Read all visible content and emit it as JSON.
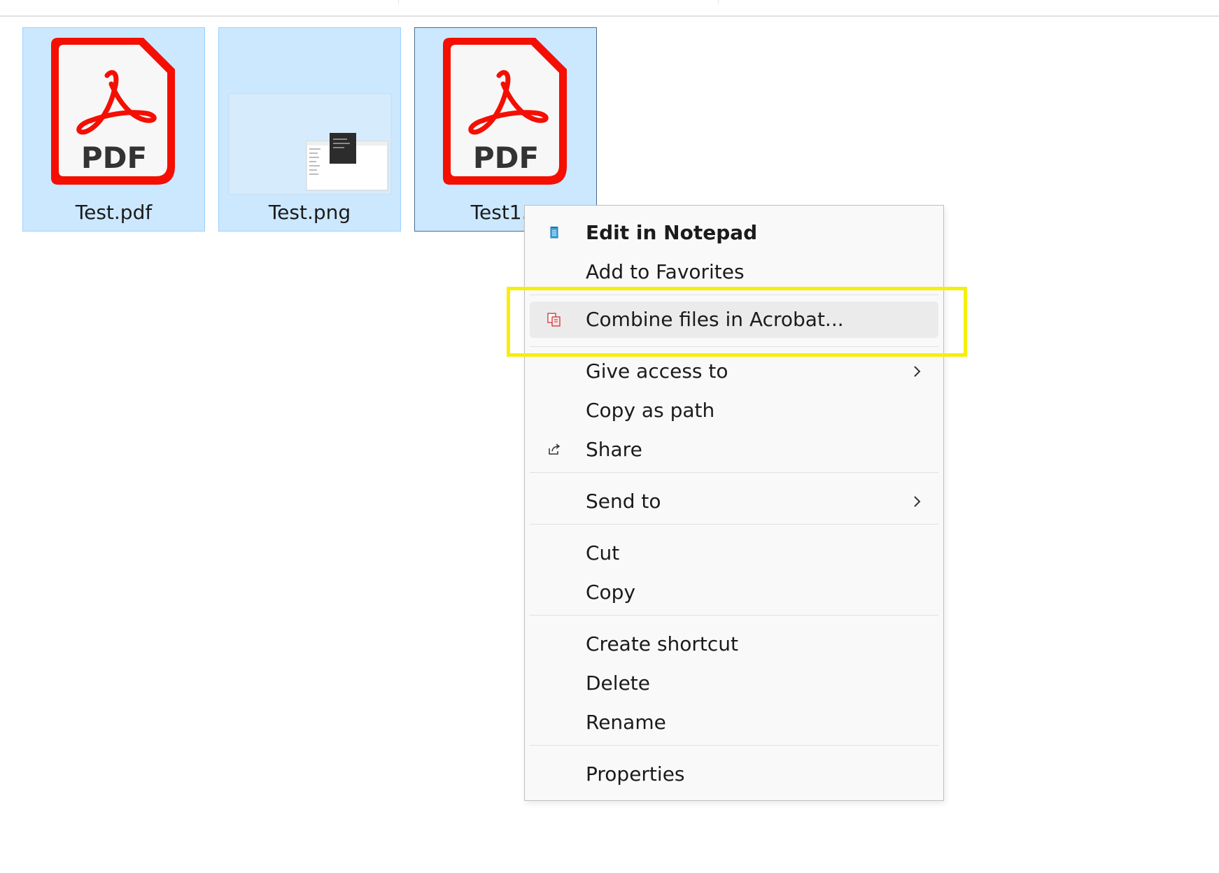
{
  "files": [
    {
      "name": "Test.pdf",
      "type": "pdf",
      "icon": "pdf-file-icon"
    },
    {
      "name": "Test.png",
      "type": "image",
      "icon": "image-thumbnail"
    },
    {
      "name": "Test1.p",
      "type": "pdf",
      "icon": "pdf-file-icon"
    }
  ],
  "pdf_badge_text": "PDF",
  "context_menu": {
    "items": [
      {
        "label": "Edit in Notepad",
        "icon": "notepad-icon",
        "bold": true
      },
      {
        "label": "Add to Favorites"
      },
      {
        "label": "Combine files in Acrobat...",
        "icon": "acrobat-combine-icon",
        "highlighted": true
      },
      {
        "label": "Give access to",
        "submenu": true
      },
      {
        "label": "Copy as path"
      },
      {
        "label": "Share",
        "icon": "share-icon"
      },
      {
        "label": "Send to",
        "submenu": true
      },
      {
        "label": "Cut"
      },
      {
        "label": "Copy"
      },
      {
        "label": "Create shortcut"
      },
      {
        "label": "Delete"
      },
      {
        "label": "Rename"
      },
      {
        "label": "Properties"
      }
    ]
  },
  "colors": {
    "selection_fill": "#cce8ff",
    "selection_border": "#99d1ff",
    "pdf_red": "#f40f02",
    "annotation_highlight": "#f5ef0a"
  }
}
